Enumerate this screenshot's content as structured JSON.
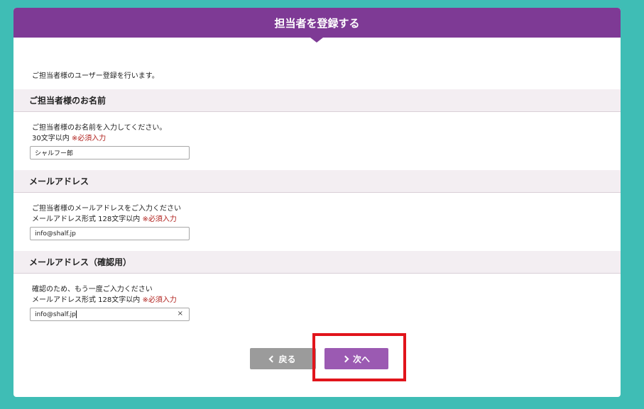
{
  "header": {
    "title": "担当者を登録する"
  },
  "intro": "ご担当者様のユーザー登録を行います。",
  "sections": {
    "name": {
      "heading": "ご担当者様のお名前",
      "desc_line1": "ご担当者様のお名前を入力してください。",
      "desc_line2": "30文字以内",
      "required": "※必須入力",
      "value": "シャルフー郎"
    },
    "email": {
      "heading": "メールアドレス",
      "desc_line1": "ご担当者様のメールアドレスをご入力ください",
      "desc_line2": "メールアドレス形式 128文字以内",
      "required": "※必須入力",
      "value": "info@shalf.jp"
    },
    "email_confirm": {
      "heading": "メールアドレス（確認用）",
      "desc_line1": "確認のため、もう一度ご入力ください",
      "desc_line2": "メールアドレス形式 128文字以内",
      "required": "※必須入力",
      "value": "info@shalf.jp",
      "clear": "×"
    }
  },
  "buttons": {
    "back": "戻る",
    "next": "次へ"
  },
  "colors": {
    "header": "#7e3a95",
    "next_button": "#9b5ab2",
    "back_button": "#9b9b9b",
    "highlight": "#e1141b",
    "background": "#3fbdb5"
  },
  "icons": {
    "back": "chevron-left-icon",
    "next": "chevron-right-icon",
    "clear": "close-icon"
  }
}
